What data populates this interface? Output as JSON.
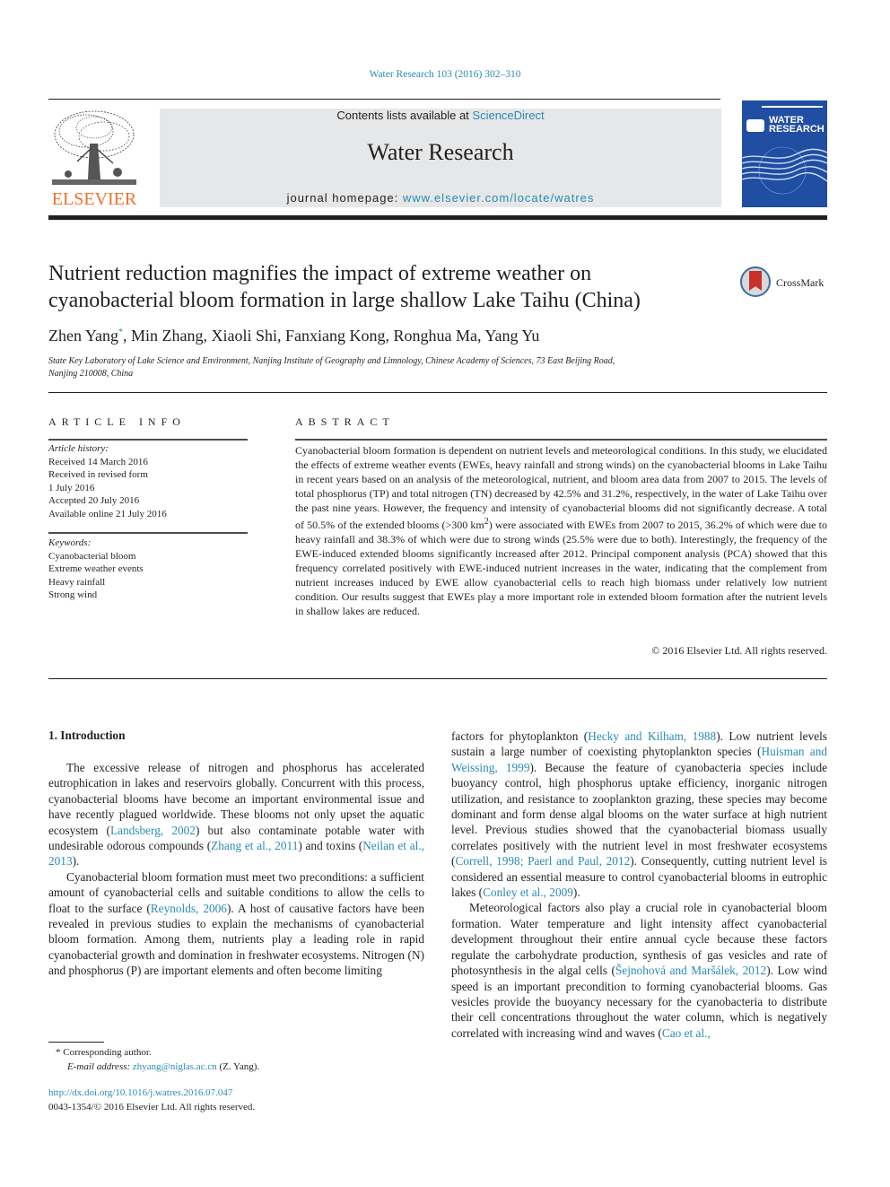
{
  "journal_ref": "Water Research 103 (2016) 302–310",
  "header": {
    "publisher_logo_text": "ELSEVIER",
    "contents_prefix": "Contents lists available at ",
    "contents_link": "ScienceDirect",
    "journal_title": "Water Research",
    "homepage_prefix": "journal homepage: ",
    "homepage_link": "www.elsevier.com/locate/watres",
    "cover_title_line1": "WATER",
    "cover_title_line2": "RESEARCH"
  },
  "crossmark_label": "CrossMark",
  "title_line1": "Nutrient reduction magnifies the impact of extreme weather on",
  "title_line2": "cyanobacterial bloom formation in large shallow Lake Taihu (China)",
  "authors": {
    "first": "Zhen Yang",
    "marker": "*",
    "rest": ", Min Zhang, Xiaoli Shi, Fanxiang Kong, Ronghua Ma, Yang Yu"
  },
  "affiliation_line1": "State Key Laboratory of Lake Science and Environment, Nanjing Institute of Geography and Limnology, Chinese Academy of Sciences, 73 East Beijing Road,",
  "affiliation_line2": "Nanjing 210008, China",
  "article_info": {
    "heading": "ARTICLE INFO",
    "history_label": "Article history:",
    "history": [
      "Received 14 March 2016",
      "Received in revised form",
      "1 July 2016",
      "Accepted 20 July 2016",
      "Available online 21 July 2016"
    ],
    "keywords_label": "Keywords:",
    "keywords": [
      "Cyanobacterial bloom",
      "Extreme weather events",
      "Heavy rainfall",
      "Strong wind"
    ]
  },
  "abstract": {
    "heading": "ABSTRACT",
    "part1": "Cyanobacterial bloom formation is dependent on nutrient levels and meteorological conditions. In this study, we elucidated the effects of extreme weather events (EWEs, heavy rainfall and strong winds) on the cyanobacterial blooms in Lake Taihu in recent years based on an analysis of the meteorological, nutrient, and bloom area data from 2007 to 2015. The levels of total phosphorus (TP) and total nitrogen (TN) decreased by 42.5% and 31.2%, respectively, in the water of Lake Taihu over the past nine years. However, the frequency and intensity of cyanobacterial blooms did not significantly decrease. A total of 50.5% of the extended blooms (>300 km",
    "sup": "2",
    "part2": ") were associated with EWEs from 2007 to 2015, 36.2% of which were due to heavy rainfall and 38.3% of which were due to strong winds (25.5% were due to both). Interestingly, the frequency of the EWE-induced extended blooms significantly increased after 2012. Principal component analysis (PCA) showed that this frequency correlated positively with EWE-induced nutrient increases in the water, indicating that the complement from nutrient increases induced by EWE allow cyanobacterial cells to reach high biomass under relatively low nutrient condition. Our results suggest that EWEs play a more important role in extended bloom formation after the nutrient levels in shallow lakes are reduced.",
    "copyright": "© 2016 Elsevier Ltd. All rights reserved."
  },
  "intro": {
    "heading": "1.  Introduction",
    "p1": {
      "a": "The excessive release of nitrogen and phosphorus has acceler­ated eutrophication in lakes and reservoirs globally. Concurrent with this process, cyanobacterial blooms have become an impor­tant environmental issue and have recently plagued worldwide. These blooms not only upset the aquatic ecosystem (",
      "c1": "Landsberg, 2002",
      "b": ") but also contaminate potable water with undesirable odorous compounds (",
      "c2": "Zhang et al., 2011",
      "c": ") and toxins (",
      "c3": "Neilan et al., 2013",
      "d": ")."
    },
    "p2": {
      "a": "Cyanobacterial bloom formation must meet two preconditions: a sufficient amount of cyanobacterial cells and suitable conditions to allow the cells to float to the surface (",
      "c1": "Reynolds, 2006",
      "b": "). A host of causative factors have been revealed in previous studies to explain the mechanisms of cyanobacterial bloom formation. Among them, nutrients play a leading role in rapid cyanobacterial growth and domination in freshwater ecosystems. Nitrogen (N) and phos­phorus (P) are important elements and often become limiting"
    },
    "p3": {
      "a": "factors for phytoplankton (",
      "c1": "Hecky and Kilham, 1988",
      "b": "). Low nutrient levels sustain a large number of coexisting phytoplankton species (",
      "c2": "Huisman and Weissing, 1999",
      "c": "). Because the feature of cyanobac­teria species include buoyancy control, high phosphorus uptake efficiency, inorganic nitrogen utilization, and resistance to zooplankton grazing, these species may become dominant and form dense algal blooms on the water surface at high nutrient level. Previous studies showed that the cyanobacterial biomass usually correlates positively with the nutrient level in most freshwater ecosystems (",
      "c3": "Correll, 1998; Paerl and Paul, 2012",
      "d": "). Consequently, cutting nutrient level is considered an essential measure to control cyanobacterial blooms in eutrophic lakes (",
      "c4": "Conley et al., 2009",
      "e": ")."
    },
    "p4": {
      "a": "Meteorological factors also play a crucial role in cyanobacterial bloom formation. Water temperature and light intensity affect cyanobacterial development throughout their entire annual cycle because these factors regulate the carbohydrate production, syn­thesis of gas vesicles and rate of photosynthesis in the algal cells (",
      "c1": "Šejnohová and Maršálek, 2012",
      "b": "). Low wind speed is an important precondition to forming cyanobacterial blooms. Gas vesicles pro­vide the buoyancy necessary for the cyanobacteria to distribute their cell concentrations throughout the water column, which is negatively correlated with increasing wind and waves (",
      "c2": "Cao et al.,"
    }
  },
  "footnote": {
    "marker": "*",
    "corresponding": "Corresponding author.",
    "email_label": "E-mail address:",
    "email": "zhyang@niglas.ac.cn",
    "email_suffix": " (Z. Yang).",
    "doi": "http://dx.doi.org/10.1016/j.watres.2016.07.047",
    "issn_copyright": "0043-1354/© 2016 Elsevier Ltd. All rights reserved."
  },
  "colors": {
    "link": "#2a8ab5",
    "elsevier_orange": "#f0712c",
    "header_box": "#e6e7e8",
    "cover_blue": "#1f4ea3",
    "crossmark_red": "#c8312b"
  }
}
